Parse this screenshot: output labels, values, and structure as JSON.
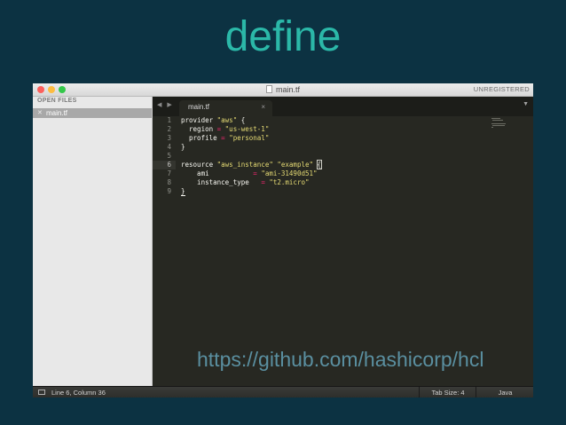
{
  "slide": {
    "title": "define",
    "link": "https://github.com/hashicorp/hcl"
  },
  "window": {
    "title": "main.tf",
    "license_label": "UNREGISTERED"
  },
  "sidebar": {
    "header": "OPEN FILES",
    "files": [
      {
        "name": "main.tf",
        "close_glyph": "✕"
      }
    ]
  },
  "tabs": [
    {
      "label": "main.tf",
      "close_glyph": "×",
      "active": true
    }
  ],
  "editor": {
    "active_line": 6,
    "line_numbers": [
      "1",
      "2",
      "3",
      "4",
      "5",
      "6",
      "7",
      "8",
      "9"
    ],
    "lines": [
      [
        {
          "t": "provider ",
          "c": "kw"
        },
        {
          "t": "\"aws\"",
          "c": "str"
        },
        {
          "t": " {",
          "c": "brace"
        }
      ],
      [
        {
          "t": "  region ",
          "c": "kw"
        },
        {
          "t": "=",
          "c": "op"
        },
        {
          "t": " ",
          "c": "kw"
        },
        {
          "t": "\"us-west-1\"",
          "c": "str"
        }
      ],
      [
        {
          "t": "  profile ",
          "c": "kw"
        },
        {
          "t": "=",
          "c": "op"
        },
        {
          "t": " ",
          "c": "kw"
        },
        {
          "t": "\"personal\"",
          "c": "str"
        }
      ],
      [
        {
          "t": "}",
          "c": "brace"
        }
      ],
      [],
      [
        {
          "t": "resource ",
          "c": "kw"
        },
        {
          "t": "\"aws_instance\"",
          "c": "str"
        },
        {
          "t": " ",
          "c": "kw"
        },
        {
          "t": "\"example\"",
          "c": "str"
        },
        {
          "t": " ",
          "c": "kw"
        },
        {
          "t": "{",
          "c": "brace cursor-bracket"
        }
      ],
      [
        {
          "t": "    ami           ",
          "c": "kw"
        },
        {
          "t": "=",
          "c": "op"
        },
        {
          "t": " ",
          "c": "kw"
        },
        {
          "t": "\"ami-31490d51\"",
          "c": "str"
        }
      ],
      [
        {
          "t": "    instance_type   ",
          "c": "kw"
        },
        {
          "t": "=",
          "c": "op"
        },
        {
          "t": " ",
          "c": "kw"
        },
        {
          "t": "\"t2.micro\"",
          "c": "str"
        }
      ],
      [
        {
          "t": "}",
          "c": "brace bracket-match"
        }
      ]
    ]
  },
  "statusbar": {
    "position": "Line 6, Column 36",
    "tab_size": "Tab Size: 4",
    "syntax": "Java"
  },
  "colors": {
    "background": "#0c3242",
    "title": "#2bb8a8",
    "link": "#5a8fa0",
    "editor_bg": "#272822",
    "string": "#e6db74",
    "operator": "#f92672"
  }
}
